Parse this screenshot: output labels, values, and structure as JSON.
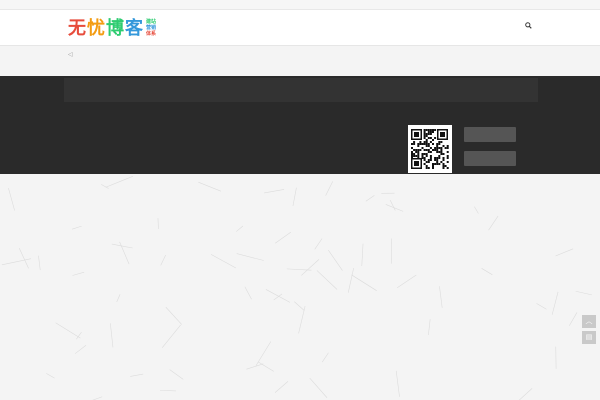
{
  "topbar": {
    "left_text": "",
    "right_links": []
  },
  "header": {
    "logo": {
      "chars": [
        "无",
        "忧",
        "博",
        "客"
      ],
      "tags": [
        "建站",
        "营销",
        "体系"
      ]
    },
    "nav": [],
    "search_icon": "search-icon"
  },
  "breadcrumb": {
    "icon": "speaker-icon",
    "text": ""
  },
  "page_note": "",
  "footer": {
    "link_rows": [],
    "about_title": "",
    "links": [],
    "copyright": "",
    "follow_title": "",
    "qq_button": "",
    "wechat_button": ""
  },
  "side_tools": {
    "top_icon": "arrow-up-icon",
    "chat_icon": "chat-icon"
  },
  "colors": {
    "accent": "#1fa3c4",
    "footer_bg": "#2a2a2a",
    "linkbar_bg": "#333333",
    "page_bg": "#f4f4f4"
  }
}
